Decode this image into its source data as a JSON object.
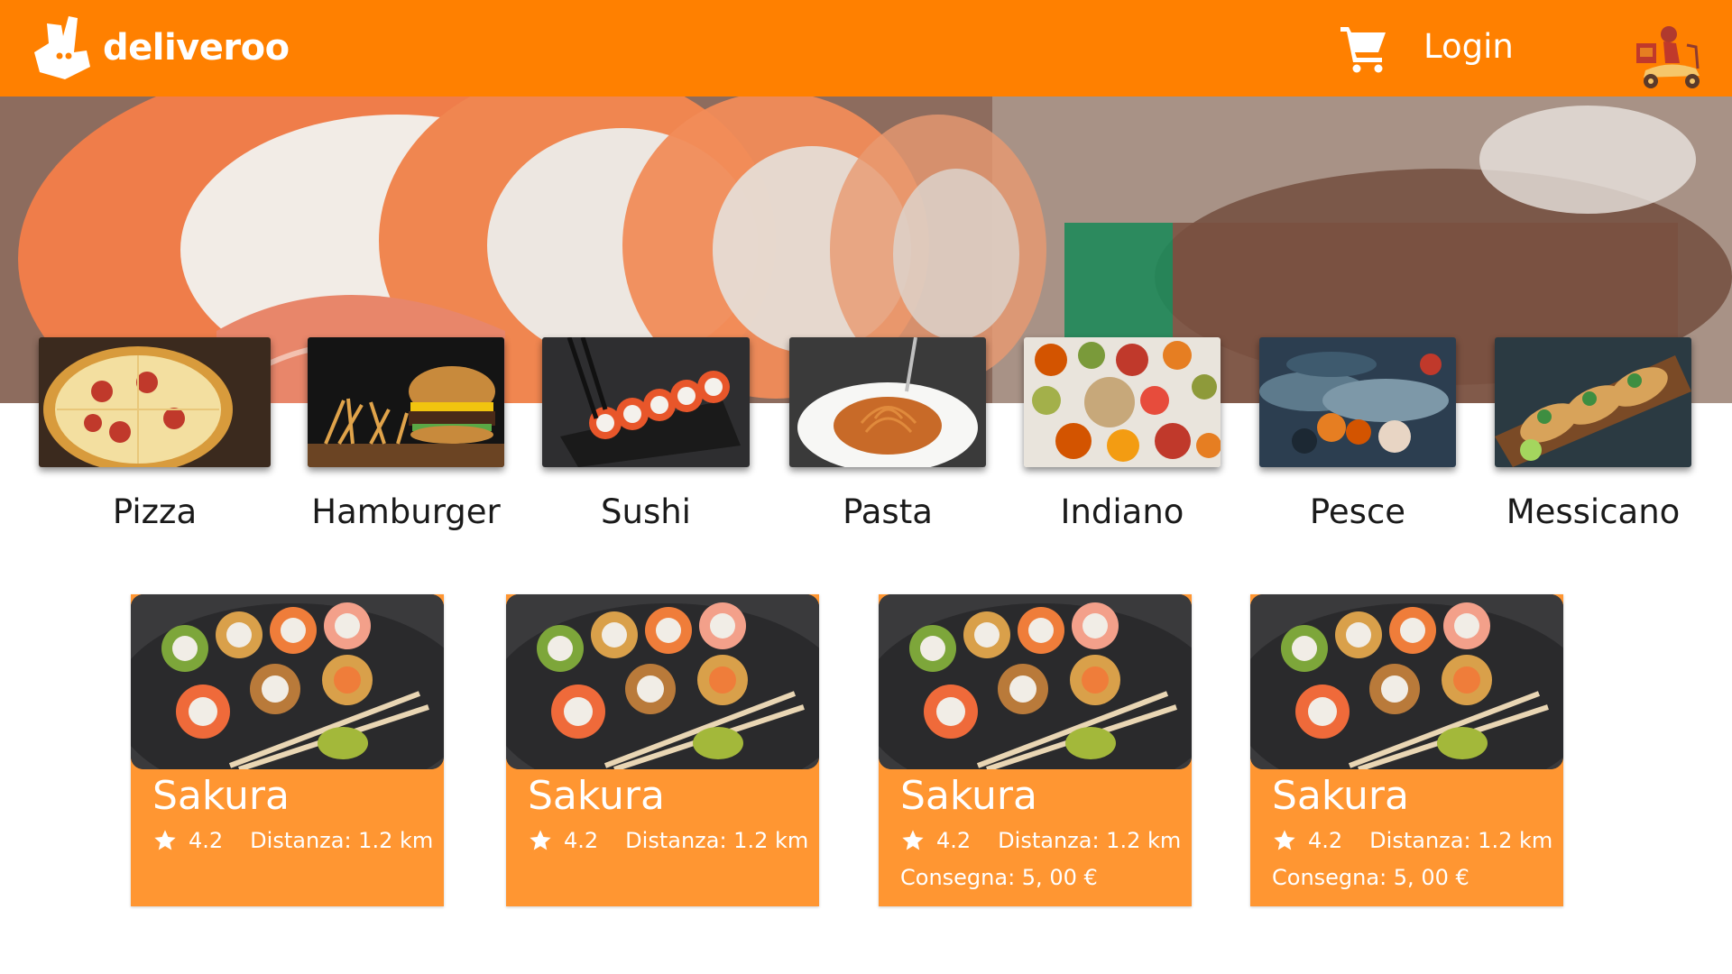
{
  "header": {
    "brand": "deliveroo",
    "login_label": "Login",
    "cart_icon": "cart-icon",
    "rider_icon": "scooter-rider-icon",
    "background_color": "#ff8000"
  },
  "categories": [
    {
      "label": "Pizza"
    },
    {
      "label": "Hamburger"
    },
    {
      "label": "Sushi"
    },
    {
      "label": "Pasta"
    },
    {
      "label": "Indiano"
    },
    {
      "label": "Pesce"
    },
    {
      "label": "Messicano"
    }
  ],
  "restaurants": [
    {
      "name": "Sakura",
      "rating": "4.2",
      "distance": "Distanza: 1.2 km",
      "delivery": ""
    },
    {
      "name": "Sakura",
      "rating": "4.2",
      "distance": "Distanza: 1.2 km",
      "delivery": ""
    },
    {
      "name": "Sakura",
      "rating": "4.2",
      "distance": "Distanza: 1.2 km",
      "delivery": "Consegna: 5, 00 €"
    },
    {
      "name": "Sakura",
      "rating": "4.2",
      "distance": "Distanza: 1.2 km",
      "delivery": "Consegna: 5, 00 €"
    }
  ],
  "colors": {
    "brand_orange": "#ff8000",
    "card_orange": "#ff9632"
  }
}
